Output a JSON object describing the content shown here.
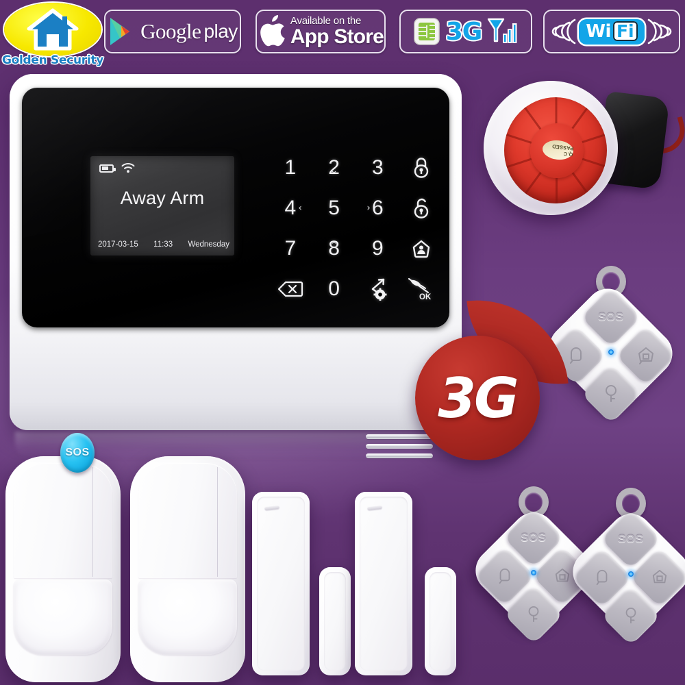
{
  "brand": {
    "name": "Golden Security",
    "logo_icon": "house-icon"
  },
  "header": {
    "badges": [
      {
        "id": "google-play",
        "primary": "Google",
        "secondary": "play",
        "icon": "google-play-triangle-icon"
      },
      {
        "id": "app-store",
        "primary": "Available on the",
        "secondary": "App Store",
        "icon": "apple-logo-icon"
      },
      {
        "id": "3g-network",
        "primary": "3G",
        "icon": "sim-card-icon",
        "icon2": "signal-bars-icon"
      },
      {
        "id": "wifi",
        "primary": "Wi",
        "secondary": "Fi",
        "icon": "wifi-waves-icon"
      }
    ]
  },
  "panel": {
    "lcd": {
      "mode": "Away Arm",
      "date": "2017-03-15",
      "time": "11:33",
      "weekday": "Wednesday",
      "battery_icon": "battery-icon",
      "wifi_icon": "wifi-icon"
    },
    "keypad": [
      {
        "label": "1",
        "name": "key-1",
        "type": "digit",
        "arrow": ""
      },
      {
        "label": "2",
        "name": "key-2",
        "type": "digit",
        "arrow": "down"
      },
      {
        "label": "3",
        "name": "key-3",
        "type": "digit",
        "arrow": ""
      },
      {
        "label": "",
        "name": "key-away-arm",
        "type": "icon",
        "icon": "lock-closed-icon",
        "arrow": ""
      },
      {
        "label": "4",
        "name": "key-4",
        "type": "digit",
        "arrow": "left"
      },
      {
        "label": "5",
        "name": "key-5",
        "type": "digit",
        "arrow": ""
      },
      {
        "label": "6",
        "name": "key-6",
        "type": "digit",
        "arrow": "right"
      },
      {
        "label": "",
        "name": "key-disarm",
        "type": "icon",
        "icon": "lock-open-icon",
        "arrow": ""
      },
      {
        "label": "7",
        "name": "key-7",
        "type": "digit",
        "arrow": ""
      },
      {
        "label": "8",
        "name": "key-8",
        "type": "digit",
        "arrow": "up"
      },
      {
        "label": "9",
        "name": "key-9",
        "type": "digit",
        "arrow": ""
      },
      {
        "label": "",
        "name": "key-home-arm",
        "type": "icon",
        "icon": "home-person-icon",
        "arrow": ""
      },
      {
        "label": "",
        "name": "key-backspace",
        "type": "icon",
        "icon": "backspace-icon",
        "arrow": ""
      },
      {
        "label": "0",
        "name": "key-0",
        "type": "digit",
        "arrow": ""
      },
      {
        "label": "",
        "name": "key-setup",
        "type": "icon",
        "icon": "setup-gear-icon",
        "arrow": ""
      },
      {
        "label": "OK",
        "name": "key-ok-mute",
        "type": "icon",
        "icon": "bell-mute-ok-icon",
        "arrow": ""
      }
    ],
    "sos_label": "SOS",
    "speaker_icon": "speaker-grille-icon"
  },
  "burst": {
    "label": "3G"
  },
  "siren": {
    "qc_label": "Q.C PASSED"
  },
  "remotes": [
    {
      "name": "remote-control-1",
      "sos": "SOS"
    },
    {
      "name": "remote-control-2",
      "sos": "SOS"
    },
    {
      "name": "remote-control-3",
      "sos": "SOS"
    }
  ],
  "accessories": {
    "pir_count": 2,
    "door_sensor_count": 2
  },
  "colors": {
    "background_purple": "#5f3070",
    "accent_blue": "#13a5e8",
    "logo_yellow": "#f7e800",
    "burst_red": "#b22a23",
    "siren_red": "#d9362a",
    "sos_cyan": "#27c2f2"
  }
}
